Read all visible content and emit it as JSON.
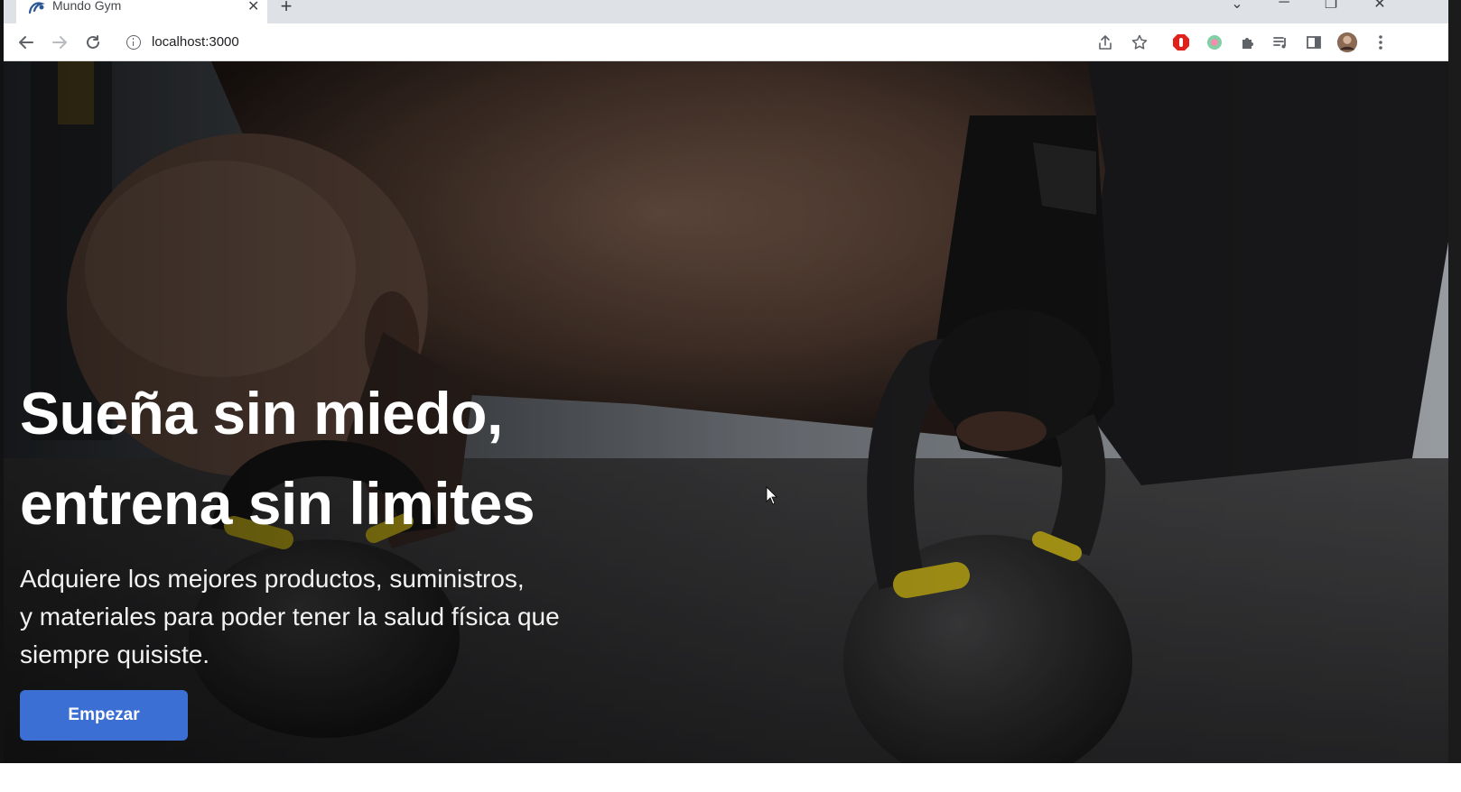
{
  "browser": {
    "tab_title": "Mundo Gym",
    "tab_close_icon": "close-icon",
    "new_tab_icon": "plus-icon",
    "url": "localhost:3000",
    "window_controls": {
      "minimize": "─",
      "restore": "❐",
      "close": "✕",
      "tab_search": "⌄"
    },
    "new_tab_glyph": "+",
    "tab_close_glyph": "✕"
  },
  "hero": {
    "title_line1": "Sueña sin miedo,",
    "title_line2": "entrena sin limites",
    "subtitle_line1": "Adquiere los mejores productos, suministros,",
    "subtitle_line2": "y materiales para poder tener la salud física que",
    "subtitle_line3": "siempre quisiste.",
    "cta_label": "Empezar"
  },
  "colors": {
    "cta": "#3b6fd4",
    "tabstrip": "#dee1e6"
  }
}
